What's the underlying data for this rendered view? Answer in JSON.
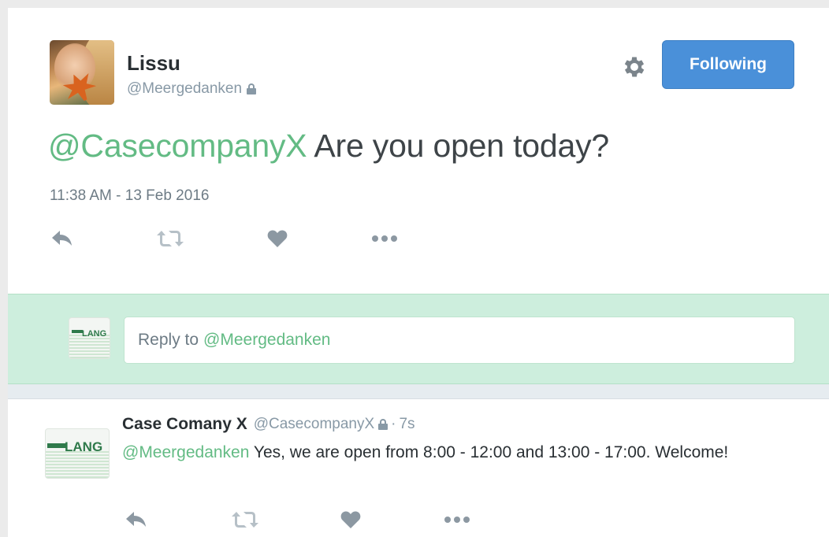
{
  "tweet": {
    "author_name": "Lissu",
    "author_handle": "@Meergedanken",
    "follow_button_label": "Following",
    "mention": "@CasecompanyX",
    "text": " Are you open today?",
    "timestamp": "11:38 AM - 13 Feb 2016",
    "icons": [
      "reply-icon",
      "retweet-icon",
      "like-icon",
      "more-icon"
    ]
  },
  "reply_box": {
    "prefix": "Reply to",
    "mention": "@Meergedanken",
    "avatar_text": "LANG"
  },
  "reply_tweet": {
    "author_name": "Case Comany X",
    "author_handle": "@CasecompanyX",
    "dot": "·",
    "time": "7s",
    "mention": "@Meergedanken",
    "text": " Yes, we are open from 8:00 - 12:00 and 13:00 - 17:00. Welcome!",
    "avatar_text": "LANG"
  },
  "colors": {
    "mention": "#63bb84",
    "follow_button": "#4a90d9",
    "reply_band": "#cdeedd",
    "icon_gray": "#8899a6"
  }
}
